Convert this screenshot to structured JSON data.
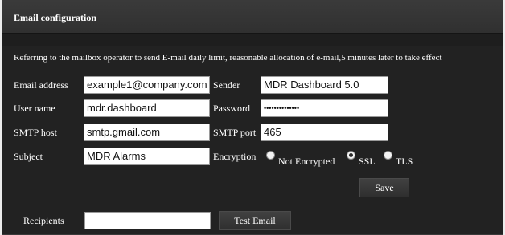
{
  "header": {
    "title": "Email configuration"
  },
  "note": "Referring to the mailbox operator to send E-mail daily limit, reasonable allocation of e-mail,5 minutes later to take effect",
  "fields": {
    "email_address": {
      "label": "Email address",
      "value": "example1@company.com"
    },
    "sender": {
      "label": "Sender",
      "value": "MDR Dashboard 5.0"
    },
    "user_name": {
      "label": "User name",
      "value": "mdr.dashboard"
    },
    "password": {
      "label": "Password",
      "value": "••••••••••••••"
    },
    "smtp_host": {
      "label": "SMTP host",
      "value": "smtp.gmail.com"
    },
    "smtp_port": {
      "label": "SMTP port",
      "value": "465"
    },
    "subject": {
      "label": "Subject",
      "value": "MDR Alarms"
    },
    "recipients": {
      "label": "Recipients",
      "value": ""
    }
  },
  "encryption": {
    "label": "Encryption",
    "options": [
      "Not Encrypted",
      "SSL",
      "TLS"
    ],
    "selected": "SSL"
  },
  "buttons": {
    "save": "Save",
    "test_email": "Test Email"
  },
  "colors": {
    "panel_bg": "#222222",
    "header_bg": "#353535",
    "text": "#ffffff"
  }
}
